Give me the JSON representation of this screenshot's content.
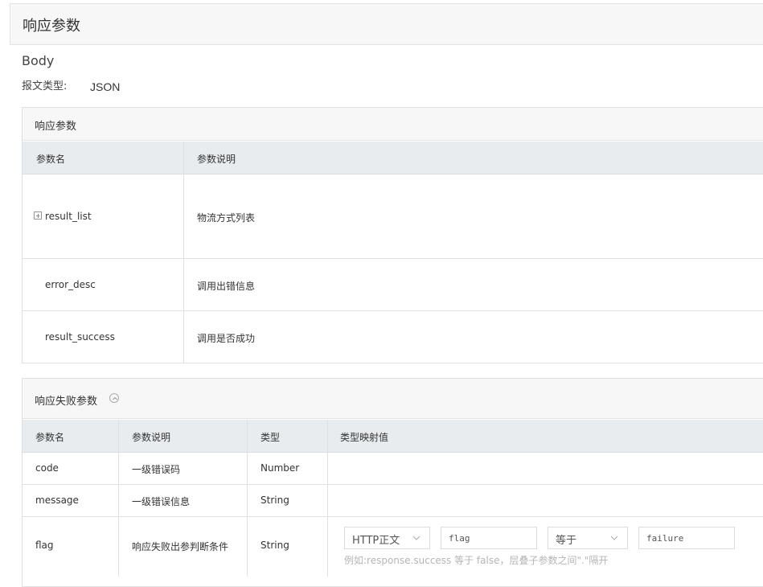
{
  "page": {
    "title": "响应参数",
    "body_title": "Body",
    "content_type_label": "报文类型:",
    "content_type_value": "JSON"
  },
  "response_params": {
    "title": "响应参数",
    "columns": [
      "参数名",
      "参数说明"
    ],
    "rows": [
      {
        "name": "result_list",
        "desc": "物流方式列表",
        "expandable": true
      },
      {
        "name": "error_desc",
        "desc": "调用出错信息"
      },
      {
        "name": "result_success",
        "desc": "调用是否成功"
      }
    ]
  },
  "failure_params": {
    "title": "响应失败参数",
    "columns": [
      "参数名",
      "参数说明",
      "类型",
      "类型映射值"
    ],
    "rows": [
      {
        "name": "code",
        "desc": "一级错误码",
        "type": "Number"
      },
      {
        "name": "message",
        "desc": "一级错误信息",
        "type": "String"
      },
      {
        "name": "flag",
        "desc": "响应失败出参判断条件",
        "type": "String"
      }
    ],
    "condition": {
      "source_select": "HTTP正文",
      "param_value": "flag",
      "operator_select": "等于",
      "compare_value": "failure",
      "hint": "例如:response.success 等于 false，层叠子参数之间\".\"隔开"
    }
  },
  "icons": {
    "expander": "plus-square-icon",
    "collapse": "chevron-up-circle-icon",
    "dropdown": "chevron-down-icon"
  }
}
